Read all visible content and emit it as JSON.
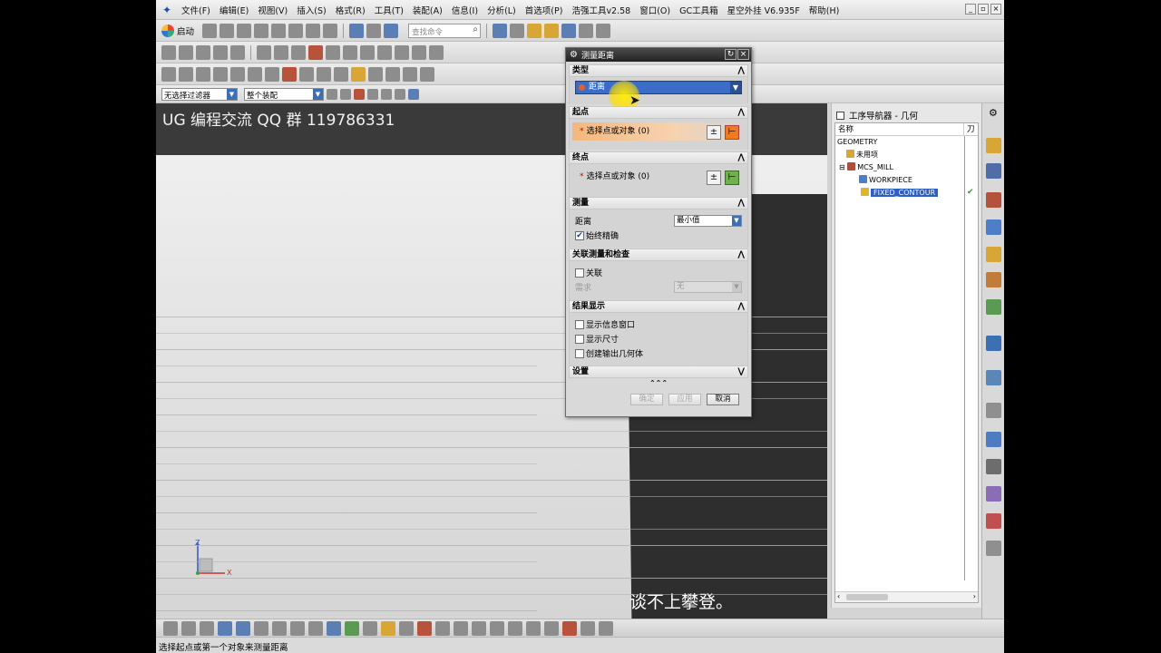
{
  "menu": {
    "items": [
      "文件(F)",
      "编辑(E)",
      "视图(V)",
      "插入(S)",
      "格式(R)",
      "工具(T)",
      "装配(A)",
      "信息(I)",
      "分析(L)",
      "首选项(P)",
      "浩强工具v2.58",
      "窗口(O)",
      "GC工具箱",
      "星空外挂 V6.935F",
      "帮助(H)"
    ]
  },
  "toolbar": {
    "start_label": "启动",
    "search_placeholder": "查找命令",
    "filter_value": "无选择过滤器",
    "assembly_value": "整个装配"
  },
  "viewport": {
    "watermark": "UG 编程交流 QQ 群 119786331",
    "subtitle": "谈不上攀登。",
    "axis_z": "Z",
    "axis_x": "X"
  },
  "dialog": {
    "title": "测量距离",
    "type_section": "类型",
    "type_value": "距离",
    "start_section": "起点",
    "start_pick": "选择点或对象 (0)",
    "end_section": "终点",
    "end_pick": "选择点或对象 (0)",
    "measure_section": "测量",
    "distance_label": "距离",
    "distance_value": "最小值",
    "always_accurate": "始终精确",
    "assoc_section": "关联测量和检查",
    "assoc_label": "关联",
    "requirement_label": "需求",
    "requirement_value": "无",
    "result_section": "结果显示",
    "show_info": "显示信息窗口",
    "show_dims": "显示尺寸",
    "create_geom": "创建输出几何体",
    "settings_section": "设置",
    "ok": "确定",
    "apply": "应用",
    "cancel": "取消"
  },
  "navigator": {
    "title": "工序导航器 - 几何",
    "col_name": "名称",
    "col_tool": "刀",
    "rows": [
      "GEOMETRY",
      "未用项",
      "MCS_MILL",
      "WORKPIECE",
      "FIXED_CONTOUR"
    ]
  },
  "status": {
    "message": "选择起点或第一个对象来测量距离"
  }
}
